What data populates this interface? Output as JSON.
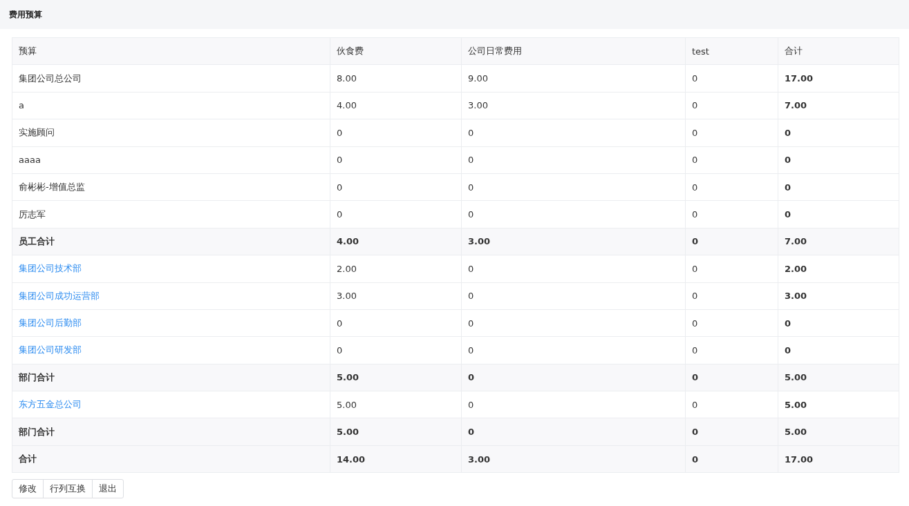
{
  "header": {
    "title": "费用预算"
  },
  "table": {
    "columns": [
      "预算",
      "伙食费",
      "公司日常费用",
      "test",
      "合计"
    ],
    "rows": [
      {
        "kind": "plain",
        "cells": [
          "集团公司总公司",
          "8.00",
          "9.00",
          "0",
          "17.00"
        ]
      },
      {
        "kind": "plain",
        "cells": [
          "a",
          "4.00",
          "3.00",
          "0",
          "7.00"
        ]
      },
      {
        "kind": "plain",
        "cells": [
          "实施顾问",
          "0",
          "0",
          "0",
          "0"
        ]
      },
      {
        "kind": "plain",
        "cells": [
          "aaaa",
          "0",
          "0",
          "0",
          "0"
        ]
      },
      {
        "kind": "plain",
        "cells": [
          "俞彬彬-增值总监",
          "0",
          "0",
          "0",
          "0"
        ]
      },
      {
        "kind": "plain",
        "cells": [
          "厉志军",
          "0",
          "0",
          "0",
          "0"
        ]
      },
      {
        "kind": "summary",
        "cells": [
          "员工合计",
          "4.00",
          "3.00",
          "0",
          "7.00"
        ]
      },
      {
        "kind": "link",
        "cells": [
          "集团公司技术部",
          "2.00",
          "0",
          "0",
          "2.00"
        ]
      },
      {
        "kind": "link",
        "cells": [
          "集团公司成功运营部",
          "3.00",
          "0",
          "0",
          "3.00"
        ]
      },
      {
        "kind": "link",
        "cells": [
          "集团公司后勤部",
          "0",
          "0",
          "0",
          "0"
        ]
      },
      {
        "kind": "link",
        "cells": [
          "集团公司研发部",
          "0",
          "0",
          "0",
          "0"
        ]
      },
      {
        "kind": "summary",
        "cells": [
          "部门合计",
          "5.00",
          "0",
          "0",
          "5.00"
        ]
      },
      {
        "kind": "link",
        "cells": [
          "东方五金总公司",
          "5.00",
          "0",
          "0",
          "5.00"
        ]
      },
      {
        "kind": "summary",
        "cells": [
          "部门合计",
          "5.00",
          "0",
          "0",
          "5.00"
        ]
      },
      {
        "kind": "summary",
        "cells": [
          "合计",
          "14.00",
          "3.00",
          "0",
          "17.00"
        ]
      }
    ]
  },
  "buttons": [
    "修改",
    "行列互换",
    "退出"
  ]
}
